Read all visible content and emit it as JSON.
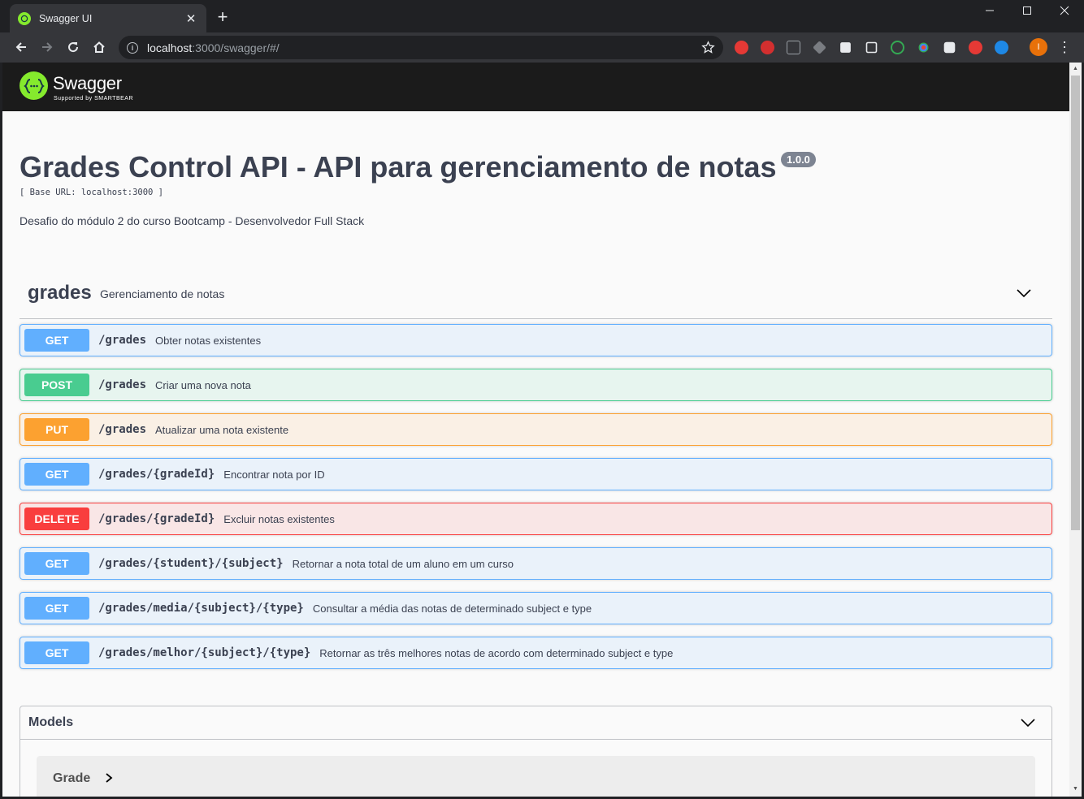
{
  "browser": {
    "tab_title": "Swagger UI",
    "url_host": "localhost",
    "url_rest": ":3000/swagger/#/",
    "profile_initial": "I"
  },
  "swagger": {
    "logo_text": "Swagger",
    "logo_subtext": "Supported by SMARTBEAR"
  },
  "info": {
    "title": "Grades Control API - API para gerenciamento de notas",
    "version": "1.0.0",
    "base_url": "[ Base URL: localhost:3000 ]",
    "description": "Desafio do módulo 2 do curso Bootcamp - Desenvolvedor Full Stack"
  },
  "tag": {
    "name": "grades",
    "description": "Gerenciamento de notas"
  },
  "operations": [
    {
      "method": "GET",
      "path": "/grades",
      "summary": "Obter notas existentes"
    },
    {
      "method": "POST",
      "path": "/grades",
      "summary": "Criar uma nova nota"
    },
    {
      "method": "PUT",
      "path": "/grades",
      "summary": "Atualizar uma nota existente"
    },
    {
      "method": "GET",
      "path": "/grades/{gradeId}",
      "summary": "Encontrar nota por ID"
    },
    {
      "method": "DELETE",
      "path": "/grades/{gradeId}",
      "summary": "Excluir notas existentes"
    },
    {
      "method": "GET",
      "path": "/grades/{student}/{subject}",
      "summary": "Retornar a nota total de um aluno em um curso"
    },
    {
      "method": "GET",
      "path": "/grades/media/{subject}/{type}",
      "summary": "Consultar a média das notas de determinado subject e type"
    },
    {
      "method": "GET",
      "path": "/grades/melhor/{subject}/{type}",
      "summary": "Retornar as três melhores notas de acordo com determinado subject e type"
    }
  ],
  "models": {
    "title": "Models",
    "items": [
      "Grade"
    ]
  },
  "colors": {
    "get": "#61affe",
    "post": "#49cc90",
    "put": "#fca130",
    "delete": "#f93e3e",
    "swagger_green": "#85ea2d"
  },
  "extension_icons": [
    "adblock-stop-icon",
    "abp-icon",
    "json-viewer-icon",
    "tag-icon",
    "trello-icon",
    "grid-icon",
    "refresh-icon",
    "color-dots-icon",
    "camera-icon",
    "vpn-icon",
    "translate-icon"
  ]
}
